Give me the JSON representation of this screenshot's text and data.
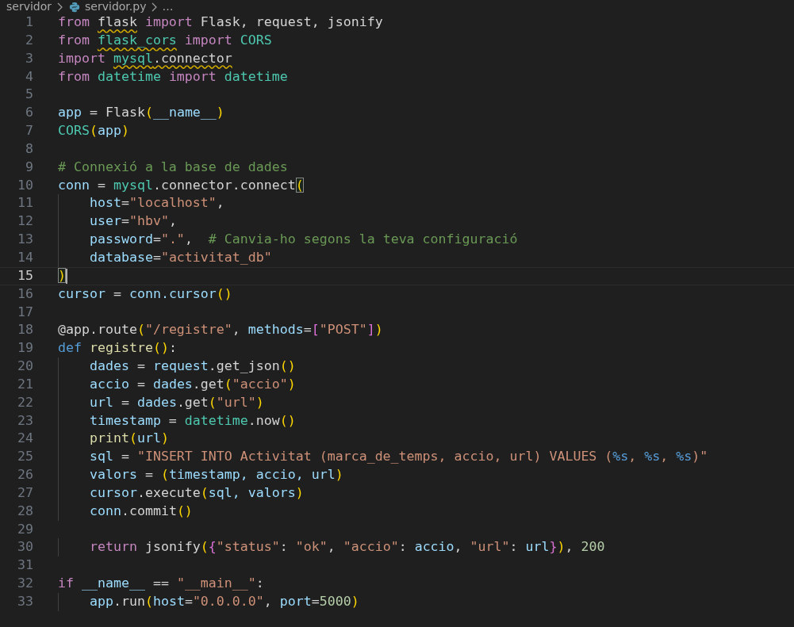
{
  "breadcrumb": {
    "folder": "servidor",
    "file": "servidor.py",
    "more": "…"
  },
  "editor": {
    "lines": [
      {
        "number": "1",
        "current": false,
        "tokens": [
          {
            "kind": "kw",
            "text": "from "
          },
          {
            "kind": "plain",
            "text": "flask",
            "squiggle": true
          },
          {
            "kind": "kw",
            "text": " import "
          },
          {
            "kind": "plain",
            "text": "Flask, request, jsonify"
          }
        ]
      },
      {
        "number": "2",
        "current": false,
        "tokens": [
          {
            "kind": "kw",
            "text": "from "
          },
          {
            "kind": "mod",
            "text": "flask_cors",
            "squiggle": true
          },
          {
            "kind": "kw",
            "text": " import "
          },
          {
            "kind": "mod",
            "text": "CORS"
          }
        ]
      },
      {
        "number": "3",
        "current": false,
        "tokens": [
          {
            "kind": "kw",
            "text": "import "
          },
          {
            "kind": "mod",
            "text": "mysql",
            "squiggle": true
          },
          {
            "kind": "plain",
            "text": ".connector",
            "squiggle": true
          }
        ]
      },
      {
        "number": "4",
        "current": false,
        "tokens": [
          {
            "kind": "kw",
            "text": "from "
          },
          {
            "kind": "mod",
            "text": "datetime"
          },
          {
            "kind": "kw",
            "text": " import "
          },
          {
            "kind": "mod",
            "text": "datetime"
          }
        ]
      },
      {
        "number": "5",
        "current": false
      },
      {
        "number": "6",
        "current": false,
        "tokens": [
          {
            "kind": "var",
            "text": "app"
          },
          {
            "kind": "plain",
            "text": " = Flask"
          },
          {
            "kind": "br1",
            "text": "("
          },
          {
            "kind": "var",
            "text": "__name__"
          },
          {
            "kind": "br1",
            "text": ")"
          }
        ]
      },
      {
        "number": "7",
        "current": false,
        "tokens": [
          {
            "kind": "mod",
            "text": "CORS"
          },
          {
            "kind": "br1",
            "text": "("
          },
          {
            "kind": "var",
            "text": "app"
          },
          {
            "kind": "br1",
            "text": ")"
          }
        ]
      },
      {
        "number": "8",
        "current": false
      },
      {
        "number": "9",
        "current": false,
        "tokens": [
          {
            "kind": "comment",
            "text": "# Connexió a la base de dades"
          }
        ]
      },
      {
        "number": "10",
        "current": false,
        "tokens": [
          {
            "kind": "var",
            "text": "conn"
          },
          {
            "kind": "plain",
            "text": " = "
          },
          {
            "kind": "mod",
            "text": "mysql"
          },
          {
            "kind": "plain",
            "text": ".connector.connect"
          },
          {
            "kind": "br1",
            "text": "(",
            "matched": true
          }
        ]
      },
      {
        "number": "11",
        "current": false,
        "tokens": [
          {
            "kind": "var",
            "text": "    host"
          },
          {
            "kind": "plain",
            "text": "="
          },
          {
            "kind": "str",
            "text": "\"localhost\""
          },
          {
            "kind": "plain",
            "text": ","
          }
        ]
      },
      {
        "number": "12",
        "current": false,
        "tokens": [
          {
            "kind": "var",
            "text": "    user"
          },
          {
            "kind": "plain",
            "text": "="
          },
          {
            "kind": "str",
            "text": "\"hbv\""
          },
          {
            "kind": "plain",
            "text": ","
          }
        ]
      },
      {
        "number": "13",
        "current": false,
        "tokens": [
          {
            "kind": "var",
            "text": "    password"
          },
          {
            "kind": "plain",
            "text": "="
          },
          {
            "kind": "str",
            "text": "\".\""
          },
          {
            "kind": "plain",
            "text": ",  "
          },
          {
            "kind": "comment",
            "text": "# Canvia-ho segons la teva configuració"
          }
        ]
      },
      {
        "number": "14",
        "current": false,
        "tokens": [
          {
            "kind": "var",
            "text": "    database"
          },
          {
            "kind": "plain",
            "text": "="
          },
          {
            "kind": "str",
            "text": "\"activitat_db\""
          }
        ]
      },
      {
        "number": "15",
        "current": true,
        "tokens": [
          {
            "kind": "br1",
            "text": ")",
            "matched": true
          }
        ]
      },
      {
        "number": "16",
        "current": false,
        "tokens": [
          {
            "kind": "var",
            "text": "cursor"
          },
          {
            "kind": "plain",
            "text": " = "
          },
          {
            "kind": "var",
            "text": "conn.cursor"
          },
          {
            "kind": "br1",
            "text": "()"
          }
        ]
      },
      {
        "number": "17",
        "current": false
      },
      {
        "number": "18",
        "current": false,
        "tokens": [
          {
            "kind": "plain",
            "text": "@app.route"
          },
          {
            "kind": "br1",
            "text": "("
          },
          {
            "kind": "str",
            "text": "\"/registre\""
          },
          {
            "kind": "plain",
            "text": ", "
          },
          {
            "kind": "var",
            "text": "methods"
          },
          {
            "kind": "plain",
            "text": "="
          },
          {
            "kind": "br2",
            "text": "["
          },
          {
            "kind": "str",
            "text": "\"POST\""
          },
          {
            "kind": "br2",
            "text": "]"
          },
          {
            "kind": "br1",
            "text": ")"
          }
        ]
      },
      {
        "number": "19",
        "current": false,
        "tokens": [
          {
            "kind": "def",
            "text": "def "
          },
          {
            "kind": "fn",
            "text": "registre"
          },
          {
            "kind": "br1",
            "text": "()"
          },
          {
            "kind": "plain",
            "text": ":"
          }
        ]
      },
      {
        "number": "20",
        "current": false,
        "tokens": [
          {
            "kind": "var",
            "text": "    dades"
          },
          {
            "kind": "plain",
            "text": " = "
          },
          {
            "kind": "var",
            "text": "request"
          },
          {
            "kind": "plain",
            "text": ".get_json"
          },
          {
            "kind": "br1",
            "text": "()"
          }
        ]
      },
      {
        "number": "21",
        "current": false,
        "tokens": [
          {
            "kind": "var",
            "text": "    accio"
          },
          {
            "kind": "plain",
            "text": " = "
          },
          {
            "kind": "var",
            "text": "dades"
          },
          {
            "kind": "plain",
            "text": ".get"
          },
          {
            "kind": "br1",
            "text": "("
          },
          {
            "kind": "str",
            "text": "\"accio\""
          },
          {
            "kind": "br1",
            "text": ")"
          }
        ]
      },
      {
        "number": "22",
        "current": false,
        "tokens": [
          {
            "kind": "var",
            "text": "    url"
          },
          {
            "kind": "plain",
            "text": " = "
          },
          {
            "kind": "var",
            "text": "dades"
          },
          {
            "kind": "plain",
            "text": ".get"
          },
          {
            "kind": "br1",
            "text": "("
          },
          {
            "kind": "str",
            "text": "\"url\""
          },
          {
            "kind": "br1",
            "text": ")"
          }
        ]
      },
      {
        "number": "23",
        "current": false,
        "tokens": [
          {
            "kind": "var",
            "text": "    timestamp"
          },
          {
            "kind": "plain",
            "text": " = "
          },
          {
            "kind": "mod",
            "text": "datetime"
          },
          {
            "kind": "plain",
            "text": ".now"
          },
          {
            "kind": "br1",
            "text": "()"
          }
        ]
      },
      {
        "number": "24",
        "current": false,
        "tokens": [
          {
            "kind": "fn",
            "text": "    print"
          },
          {
            "kind": "br1",
            "text": "("
          },
          {
            "kind": "var",
            "text": "url"
          },
          {
            "kind": "br1",
            "text": ")"
          }
        ]
      },
      {
        "number": "25",
        "current": false,
        "tokens": [
          {
            "kind": "var",
            "text": "    sql"
          },
          {
            "kind": "plain",
            "text": " = "
          },
          {
            "kind": "str",
            "text": "\"INSERT INTO Activitat (marca_de_temps, accio, url) VALUES ("
          },
          {
            "kind": "fmt",
            "text": "%s"
          },
          {
            "kind": "str",
            "text": ", "
          },
          {
            "kind": "fmt",
            "text": "%s"
          },
          {
            "kind": "str",
            "text": ", "
          },
          {
            "kind": "fmt",
            "text": "%s"
          },
          {
            "kind": "str",
            "text": ")\""
          }
        ]
      },
      {
        "number": "26",
        "current": false,
        "tokens": [
          {
            "kind": "var",
            "text": "    valors"
          },
          {
            "kind": "plain",
            "text": " = "
          },
          {
            "kind": "br1",
            "text": "("
          },
          {
            "kind": "var",
            "text": "timestamp, accio, url"
          },
          {
            "kind": "br1",
            "text": ")"
          }
        ]
      },
      {
        "number": "27",
        "current": false,
        "tokens": [
          {
            "kind": "var",
            "text": "    cursor"
          },
          {
            "kind": "plain",
            "text": ".execute"
          },
          {
            "kind": "br1",
            "text": "("
          },
          {
            "kind": "var",
            "text": "sql, valors"
          },
          {
            "kind": "br1",
            "text": ")"
          }
        ]
      },
      {
        "number": "28",
        "current": false,
        "tokens": [
          {
            "kind": "var",
            "text": "    conn"
          },
          {
            "kind": "plain",
            "text": ".commit"
          },
          {
            "kind": "br1",
            "text": "()"
          }
        ]
      },
      {
        "number": "29",
        "current": false
      },
      {
        "number": "30",
        "current": false,
        "tokens": [
          {
            "kind": "kw",
            "text": "    return "
          },
          {
            "kind": "plain",
            "text": "jsonify"
          },
          {
            "kind": "br1",
            "text": "("
          },
          {
            "kind": "br2",
            "text": "{"
          },
          {
            "kind": "str",
            "text": "\"status\""
          },
          {
            "kind": "plain",
            "text": ": "
          },
          {
            "kind": "str",
            "text": "\"ok\""
          },
          {
            "kind": "plain",
            "text": ", "
          },
          {
            "kind": "str",
            "text": "\"accio\""
          },
          {
            "kind": "plain",
            "text": ": "
          },
          {
            "kind": "var",
            "text": "accio"
          },
          {
            "kind": "plain",
            "text": ", "
          },
          {
            "kind": "str",
            "text": "\"url\""
          },
          {
            "kind": "plain",
            "text": ": "
          },
          {
            "kind": "var",
            "text": "url"
          },
          {
            "kind": "br2",
            "text": "}"
          },
          {
            "kind": "br1",
            "text": ")"
          },
          {
            "kind": "plain",
            "text": ", "
          },
          {
            "kind": "num",
            "text": "200"
          }
        ]
      },
      {
        "number": "31",
        "current": false
      },
      {
        "number": "32",
        "current": false,
        "tokens": [
          {
            "kind": "kw",
            "text": "if "
          },
          {
            "kind": "var",
            "text": "__name__"
          },
          {
            "kind": "plain",
            "text": " == "
          },
          {
            "kind": "str",
            "text": "\"__main__\""
          },
          {
            "kind": "plain",
            "text": ":"
          }
        ]
      },
      {
        "number": "33",
        "current": false,
        "tokens": [
          {
            "kind": "var",
            "text": "    app"
          },
          {
            "kind": "plain",
            "text": ".run"
          },
          {
            "kind": "br1",
            "text": "("
          },
          {
            "kind": "var",
            "text": "host"
          },
          {
            "kind": "plain",
            "text": "="
          },
          {
            "kind": "str",
            "text": "\"0.0.0.0\""
          },
          {
            "kind": "plain",
            "text": ", "
          },
          {
            "kind": "var",
            "text": "port"
          },
          {
            "kind": "plain",
            "text": "="
          },
          {
            "kind": "num",
            "text": "5000"
          },
          {
            "kind": "br1",
            "text": ")"
          }
        ]
      }
    ]
  }
}
